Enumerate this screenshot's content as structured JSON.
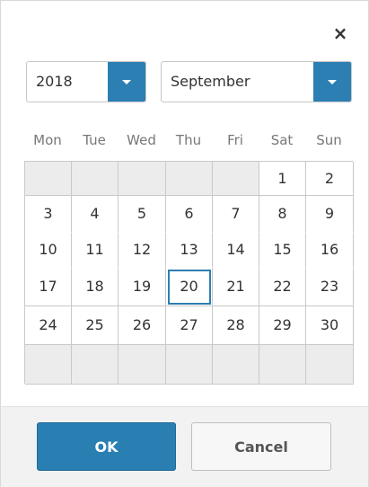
{
  "close_label": "×",
  "year": {
    "value": "2018"
  },
  "month": {
    "value": "September"
  },
  "weekdays": [
    "Mon",
    "Tue",
    "Wed",
    "Thu",
    "Fri",
    "Sat",
    "Sun"
  ],
  "calendar": {
    "weeks": [
      [
        "",
        "",
        "",
        "",
        "",
        "1",
        "2"
      ],
      [
        "3",
        "4",
        "5",
        "6",
        "7",
        "8",
        "9"
      ],
      [
        "10",
        "11",
        "12",
        "13",
        "14",
        "15",
        "16"
      ],
      [
        "17",
        "18",
        "19",
        "20",
        "21",
        "22",
        "23"
      ],
      [
        "24",
        "25",
        "26",
        "27",
        "28",
        "29",
        "30"
      ],
      [
        "",
        "",
        "",
        "",
        "",
        "",
        ""
      ]
    ],
    "selected_day": "20"
  },
  "footer": {
    "ok_label": "OK",
    "cancel_label": "Cancel"
  },
  "colors": {
    "accent": "#2c7fb3",
    "empty_cell": "#ececec",
    "footer_bg": "#f2f2f2"
  }
}
